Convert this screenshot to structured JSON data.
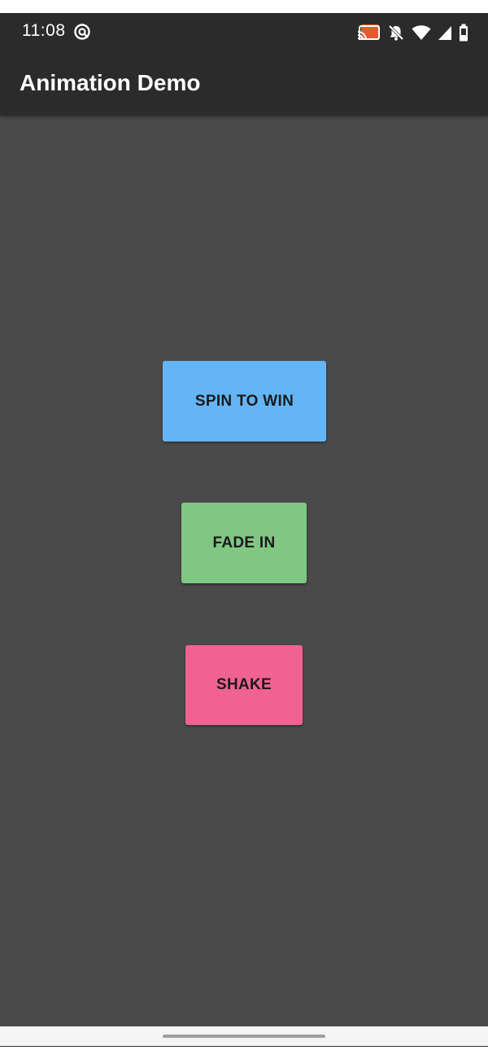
{
  "status_bar": {
    "time": "11:08",
    "icons": [
      "auto-sync-icon",
      "cast-icon",
      "mute-notifications-icon",
      "wifi-icon",
      "cell-signal-icon",
      "battery-icon"
    ]
  },
  "app_bar": {
    "title": "Animation Demo"
  },
  "buttons": {
    "spin": {
      "label": "SPIN TO WIN",
      "color": "#64b5f6"
    },
    "fade": {
      "label": "FADE IN",
      "color": "#81c784"
    },
    "shake": {
      "label": "SHAKE",
      "color": "#f06292"
    }
  },
  "colors": {
    "app_bar": "#2b2b2b",
    "background": "#4a4a4a",
    "cast_accent": "#e8582d"
  }
}
